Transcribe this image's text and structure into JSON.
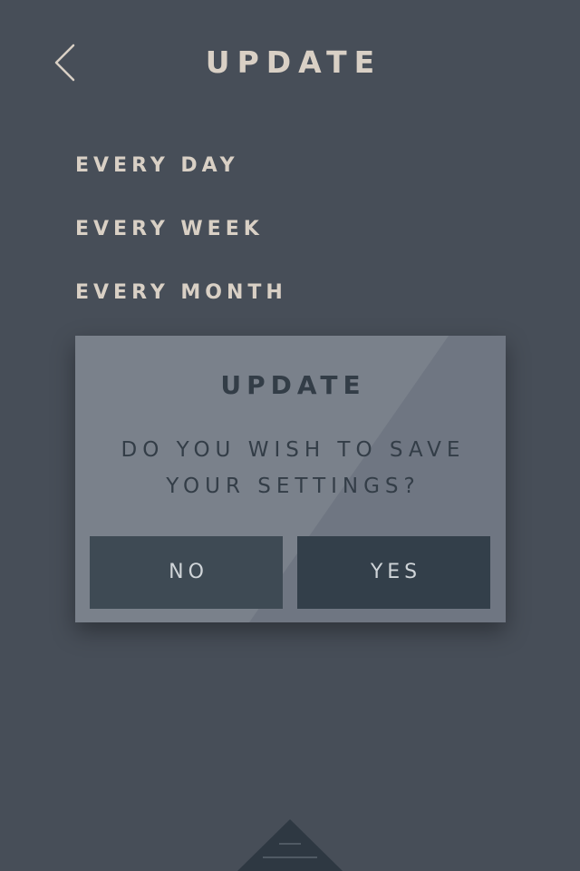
{
  "header": {
    "title": "UPDATE",
    "back_icon": "chevron-left-icon"
  },
  "options": [
    {
      "label": "EVERY DAY"
    },
    {
      "label": "EVERY WEEK"
    },
    {
      "label": "EVERY MONTH"
    }
  ],
  "dialog": {
    "title": "UPDATE",
    "message_line1": "DO YOU WISH TO SAVE",
    "message_line2": "YOUR SETTINGS?",
    "no_label": "NO",
    "yes_label": "YES"
  },
  "bottom_tab": {
    "icon": "menu-lines-icon"
  },
  "colors": {
    "background": "#474e58",
    "text_light": "#d9d0c5",
    "dialog_background": "#7a818b",
    "dialog_text": "#333d47",
    "button_no": "#3e4a54",
    "button_yes": "#333f4a",
    "bottom_tab": "#2e3842"
  }
}
